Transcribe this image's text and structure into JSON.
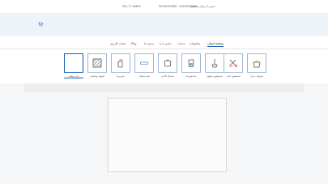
{
  "topbar": {
    "phone1": "021-77-40800",
    "phones": "09126322990 - 09195976601",
    "contact": "تماس با ارسال مستقیم"
  },
  "cart": {
    "icon": "cart-icon"
  },
  "nav": [
    {
      "label": "حساب کاربری"
    },
    {
      "label": "وبلاگ"
    },
    {
      "label": "درباره ما"
    },
    {
      "label": "تماس با ما"
    },
    {
      "label": "خدمات"
    },
    {
      "label": "محصولات"
    },
    {
      "label": "صفحه اصلی"
    }
  ],
  "categories": [
    {
      "label": "ابزار خیاطی",
      "icon": "empty-box-icon"
    },
    {
      "label": "کفپوش بهداشتی",
      "icon": "tile-icon"
    },
    {
      "label": "اسپری‌ها",
      "icon": "spray-icon"
    },
    {
      "label": "لوله مسواک",
      "icon": "tube-icon"
    },
    {
      "label": "دستمال کاغذی",
      "icon": "tissue-icon"
    },
    {
      "label": "ضدعفونی‌ها",
      "icon": "bottle-icon"
    },
    {
      "label": "شستشوی سطوح",
      "icon": "mop-icon"
    },
    {
      "label": "شستشوی لباس",
      "icon": "scissors-icon"
    },
    {
      "label": "ملزومات منزل",
      "icon": "bag-icon"
    }
  ],
  "colors": {
    "accent": "#1a5fb4",
    "hero": "#eef3f9",
    "border": "#9fb7d6"
  }
}
